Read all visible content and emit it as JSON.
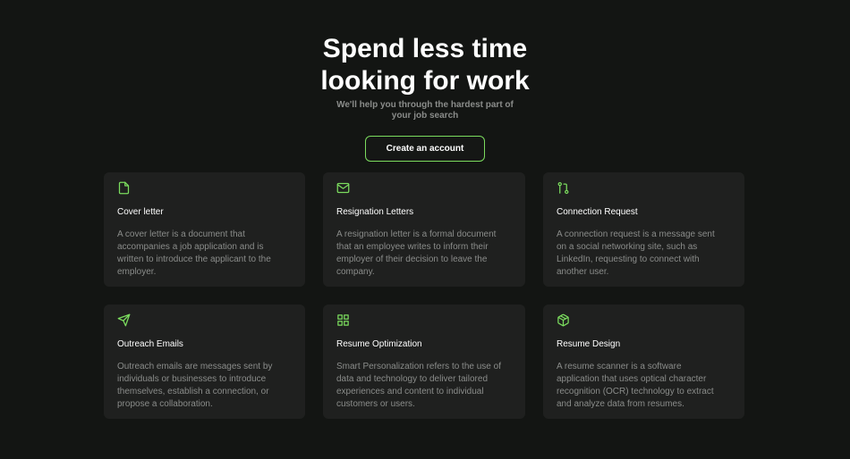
{
  "hero": {
    "title": "Spend less time looking for work",
    "subtitle": "We'll help you through the hardest part of your job search",
    "cta_label": "Create an account"
  },
  "colors": {
    "background": "#131513",
    "card": "#1f201f",
    "accent": "#7bdc5e",
    "muted_text": "#8a8c8a"
  },
  "features": [
    {
      "icon": "file-icon",
      "title": "Cover letter",
      "description": "A cover letter is a document that accompanies a job application and is written to introduce the applicant to the employer."
    },
    {
      "icon": "mail-icon",
      "title": "Resignation Letters",
      "description": "A resignation letter is a formal document that an employee writes to inform their employer of their decision to leave the company."
    },
    {
      "icon": "git-pull-request-icon",
      "title": "Connection Request",
      "description": "A connection request is a message sent on a social networking site, such as LinkedIn, requesting to connect with another user."
    },
    {
      "icon": "send-icon",
      "title": "Outreach Emails",
      "description": "Outreach emails are messages sent by individuals or businesses to introduce themselves, establish a connection, or propose a collaboration."
    },
    {
      "icon": "grid-icon",
      "title": "Resume Optimization",
      "description": "Smart Personalization refers to the use of data and technology to deliver tailored experiences and content to individual customers or users."
    },
    {
      "icon": "box-icon",
      "title": "Resume Design",
      "description": "A resume scanner is a software application that uses optical character recognition (OCR) technology to extract and analyze data from resumes."
    }
  ]
}
